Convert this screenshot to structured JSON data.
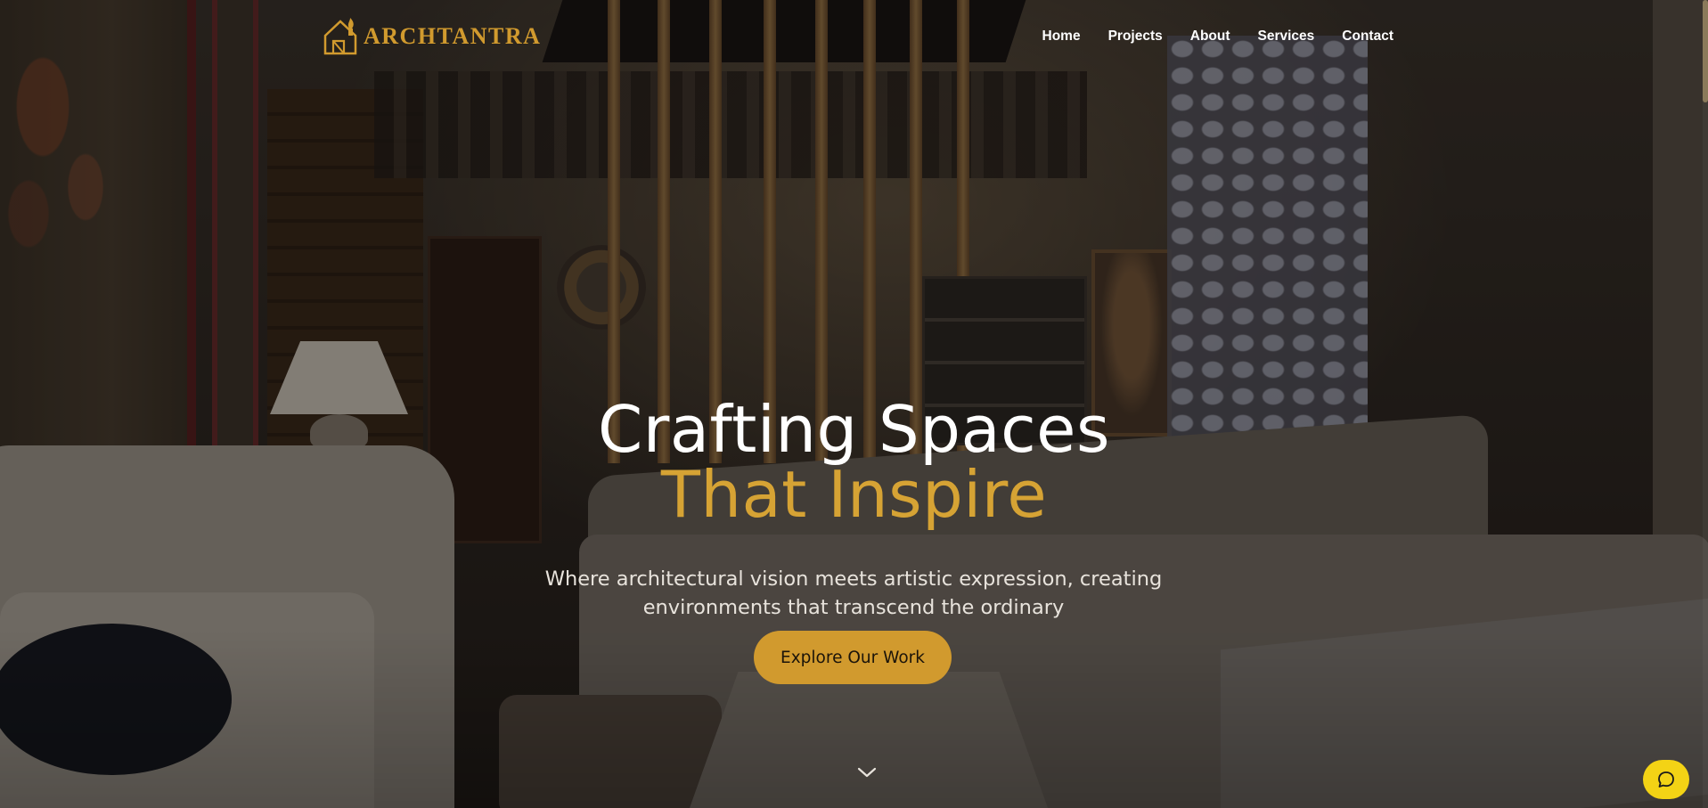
{
  "brand": {
    "name": "ARCHTANTRA",
    "accent_color": "#d19a2e",
    "logo_icon": "house-with-flame-logo-icon"
  },
  "nav": {
    "items": [
      {
        "label": "Home"
      },
      {
        "label": "Projects"
      },
      {
        "label": "About"
      },
      {
        "label": "Services"
      },
      {
        "label": "Contact"
      }
    ]
  },
  "hero": {
    "title_line1": "Crafting Spaces",
    "title_line2": "That Inspire",
    "title_line2_color": "#d6a334",
    "subtitle": "Where architectural vision meets artistic expression, creating environments that transcend the ordinary",
    "cta_label": "Explore Our Work",
    "scroll_icon": "chevron-down-icon"
  },
  "chat": {
    "icon": "chat-bubble-icon",
    "color": "#f3d315"
  }
}
